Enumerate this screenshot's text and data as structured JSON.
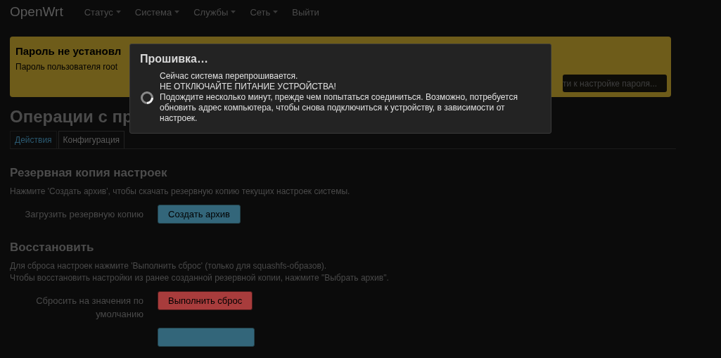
{
  "navbar": {
    "brand": "OpenWrt",
    "menu": [
      {
        "label": "Статус",
        "dropdown": true
      },
      {
        "label": "Система",
        "dropdown": true
      },
      {
        "label": "Службы",
        "dropdown": true
      },
      {
        "label": "Сеть",
        "dropdown": true
      },
      {
        "label": "Выйти",
        "dropdown": false
      }
    ]
  },
  "alert": {
    "title": "Пароль не установл",
    "text": "Пароль пользователя root",
    "button": "ти к настройке пароля..."
  },
  "page_title": "Операции с пр",
  "tabs": [
    {
      "label": "Действия",
      "selected": true
    },
    {
      "label": "Конфигурация",
      "selected": false
    }
  ],
  "sections": [
    {
      "title": "Резервная копия настроек",
      "description": [
        "Нажмите 'Создать архив', чтобы скачать резервную копию текущих настроек системы."
      ],
      "rows": [
        {
          "label": "Загрузить резервную копию",
          "button": "Создать архив",
          "kind": "action"
        }
      ]
    },
    {
      "title": "Восстановить",
      "description": [
        "Для сброса настроек нажмите 'Выполнить сброс' (только для squashfs-образов).",
        "Чтобы восстановить настройки из ранее созданной резервной копии, нажмите \"Выбрать архив\"."
      ],
      "rows": [
        {
          "label": "Сбросить на значения по умолчанию",
          "button": "Выполнить сброс",
          "kind": "danger"
        },
        {
          "kind": "action"
        }
      ]
    }
  ],
  "modal": {
    "title": "Прошивка…",
    "lines": [
      "Сейчас система перепрошивается.",
      "НЕ ОТКЛЮЧАЙТЕ ПИТАНИЕ УСТРОЙСТВА!",
      "Подождите несколько минут, прежде чем попытаться соединиться. Возможно, потребуется обновить адрес компьютера, чтобы снова подключиться к устройству, в зависимости от настроек."
    ]
  }
}
